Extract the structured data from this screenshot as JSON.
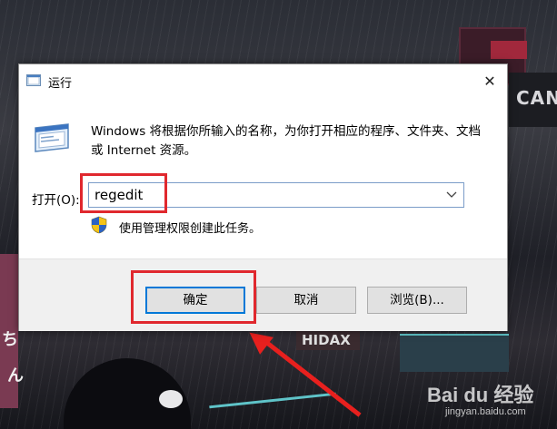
{
  "dialog": {
    "title": "运行",
    "description": "Windows 将根据你所输入的名称，为你打开相应的程序、文件夹、文档或 Internet 资源。",
    "open_label": "打开(O):",
    "command_value": "regedit",
    "admin_note": "使用管理权限创建此任务。",
    "close_glyph": "✕"
  },
  "buttons": {
    "ok": "确定",
    "cancel": "取消",
    "browse": "浏览(B)..."
  },
  "wallpaper": {
    "sign_text": "CAN",
    "shop_text": "HIDAX",
    "char1": "ち",
    "char2": "ん"
  },
  "watermark": {
    "logo": "Bai du 经验",
    "url": "jingyan.baidu.com"
  },
  "colors": {
    "annotation_red": "#e0282e",
    "accent_blue": "#0078d7"
  }
}
